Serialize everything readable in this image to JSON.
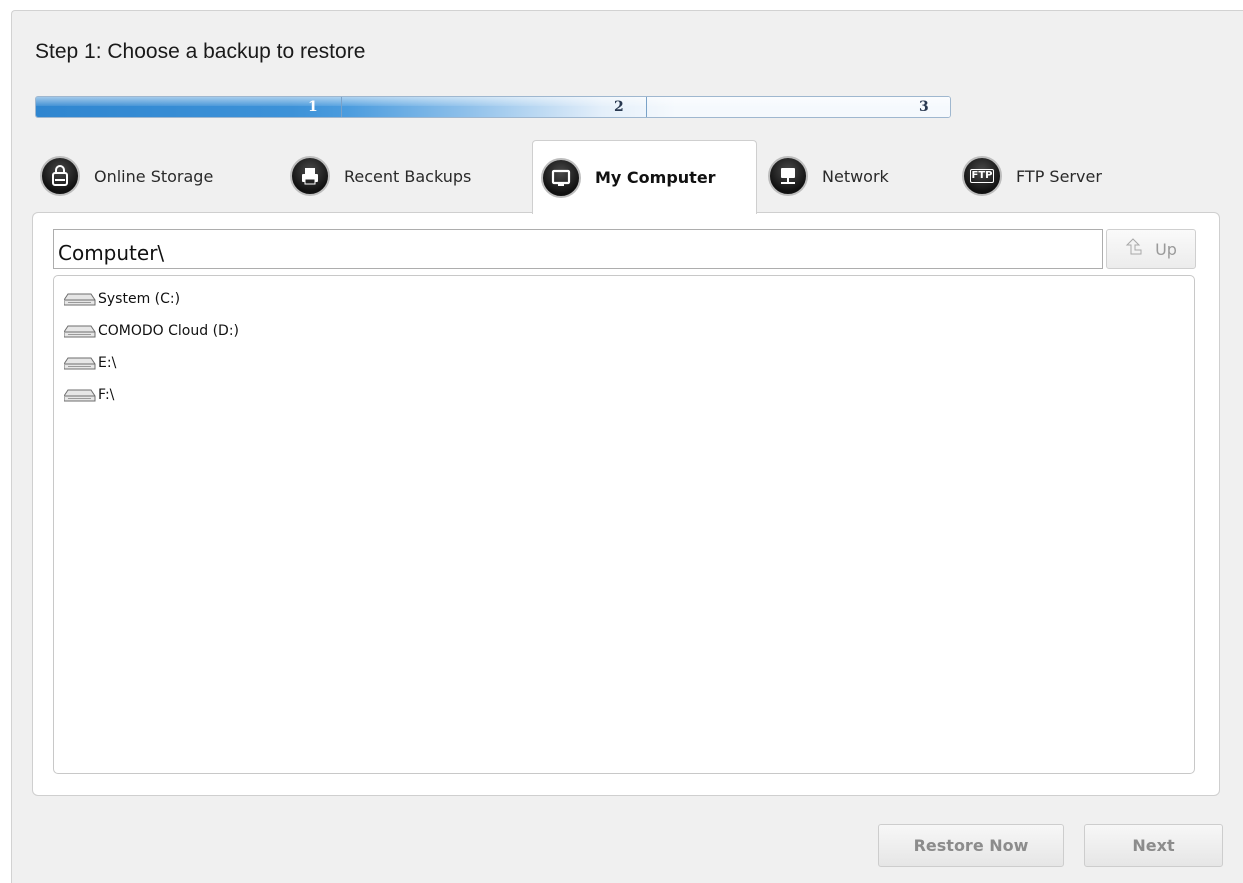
{
  "title": "Step 1: Choose a backup to restore",
  "progress": {
    "steps": [
      "1",
      "2",
      "3"
    ],
    "current_step": 1,
    "fill_fraction": 0.5,
    "colors": {
      "fill": "#2f86d0",
      "track": "#f5f9fd"
    }
  },
  "tabs": [
    {
      "label": "Online Storage",
      "icon": "hdd-lock-icon",
      "active": false
    },
    {
      "label": "Recent Backups",
      "icon": "printer-icon",
      "active": false
    },
    {
      "label": "My Computer",
      "icon": "monitor-icon",
      "active": true
    },
    {
      "label": "Network",
      "icon": "network-computer-icon",
      "active": false
    },
    {
      "label": "FTP Server",
      "icon": "ftp-icon",
      "active": false
    }
  ],
  "tab_icon_text": {
    "ftp": "FTP"
  },
  "browser": {
    "path": "Computer\\",
    "up_label": "Up",
    "items": [
      {
        "label": "System (C:)",
        "icon": "drive-icon"
      },
      {
        "label": "COMODO Cloud (D:)",
        "icon": "drive-icon"
      },
      {
        "label": "E:\\",
        "icon": "drive-icon"
      },
      {
        "label": "F:\\",
        "icon": "drive-icon"
      }
    ]
  },
  "footer": {
    "restore_now": "Restore Now",
    "next": "Next"
  }
}
